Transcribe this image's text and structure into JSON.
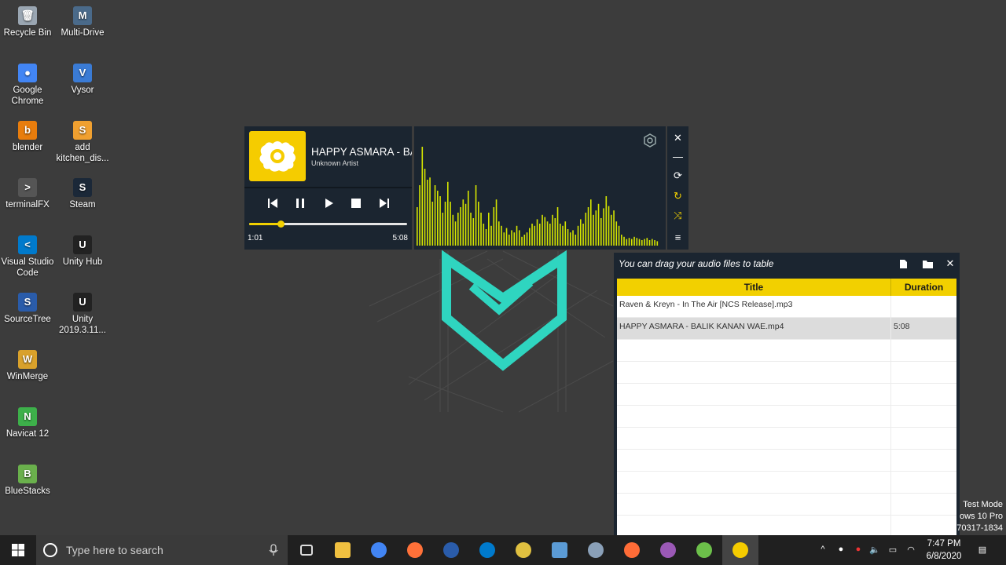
{
  "desktop": {
    "icons": [
      {
        "label": "Recycle Bin",
        "color": "#9aa6b2",
        "glyph": "🗑"
      },
      {
        "label": "Multi-Drive",
        "color": "#4a6a8a",
        "glyph": "M"
      },
      {
        "label": "Google Chrome",
        "color": "#4285f4",
        "glyph": "●"
      },
      {
        "label": "Vysor",
        "color": "#3a7bd5",
        "glyph": "V"
      },
      {
        "label": "blender",
        "color": "#e87d0d",
        "glyph": "b"
      },
      {
        "label": "add kitchen_dis...",
        "color": "#f0a030",
        "glyph": "S"
      },
      {
        "label": "terminalFX",
        "color": "#555555",
        "glyph": ">"
      },
      {
        "label": "Steam",
        "color": "#1b2838",
        "glyph": "S"
      },
      {
        "label": "Visual Studio Code",
        "color": "#007acc",
        "glyph": "<"
      },
      {
        "label": "Unity Hub",
        "color": "#222222",
        "glyph": "U"
      },
      {
        "label": "SourceTree",
        "color": "#2a5caa",
        "glyph": "S"
      },
      {
        "label": "Unity 2019.3.11...",
        "color": "#222222",
        "glyph": "U"
      },
      {
        "label": "WinMerge",
        "color": "#d9a12b",
        "glyph": "W"
      },
      {
        "label": "Navicat 12",
        "color": "#3db04a",
        "glyph": "N"
      },
      {
        "label": "BlueStacks",
        "color": "#6ab04c",
        "glyph": "B"
      }
    ]
  },
  "player": {
    "title": "HAPPY ASMARA - BALIK KANAN WAE",
    "artist": "Unknown Artist",
    "current_time": "1:01",
    "total_time": "5:08",
    "progress": 0.2,
    "accent": "#f2d000",
    "panel_bg": "#1b2530"
  },
  "visualizer": {
    "bar_color": "#d6e600",
    "levels": [
      0.35,
      0.55,
      0.9,
      0.7,
      0.6,
      0.62,
      0.4,
      0.55,
      0.5,
      0.45,
      0.3,
      0.4,
      0.58,
      0.4,
      0.28,
      0.22,
      0.3,
      0.35,
      0.42,
      0.38,
      0.5,
      0.3,
      0.25,
      0.55,
      0.4,
      0.3,
      0.2,
      0.15,
      0.3,
      0.18,
      0.35,
      0.42,
      0.22,
      0.18,
      0.12,
      0.16,
      0.1,
      0.14,
      0.12,
      0.18,
      0.14,
      0.08,
      0.1,
      0.12,
      0.16,
      0.2,
      0.18,
      0.24,
      0.2,
      0.28,
      0.26,
      0.22,
      0.2,
      0.28,
      0.25,
      0.35,
      0.2,
      0.18,
      0.22,
      0.15,
      0.12,
      0.14,
      0.1,
      0.18,
      0.24,
      0.2,
      0.3,
      0.35,
      0.42,
      0.28,
      0.32,
      0.38,
      0.25,
      0.34,
      0.45,
      0.36,
      0.28,
      0.32,
      0.22,
      0.18,
      0.1,
      0.08,
      0.06,
      0.07,
      0.06,
      0.08,
      0.07,
      0.06,
      0.05,
      0.06,
      0.07,
      0.05,
      0.06,
      0.05,
      0.04
    ]
  },
  "side_buttons": [
    "✕",
    "—",
    "⟳",
    "↻",
    "⤨",
    "≡"
  ],
  "playlist": {
    "hint": "You can drag your audio files to table",
    "columns": {
      "title": "Title",
      "duration": "Duration"
    },
    "rows": [
      {
        "title": "Raven & Kreyn - In The Air [NCS Release].mp3",
        "duration": ""
      },
      {
        "title": "HAPPY ASMARA - BALIK KANAN WAE.mp4",
        "duration": "5:08",
        "selected": true
      }
    ],
    "empty_rows": 9
  },
  "watermark": {
    "line1": "Test Mode",
    "line2": "ows 10 Pro",
    "line3": "70317-1834"
  },
  "taskbar": {
    "search_placeholder": "Type here to search",
    "time": "7:47 PM",
    "date": "6/8/2020",
    "apps": [
      {
        "name": "task-view",
        "color": "#202020"
      },
      {
        "name": "file-explorer",
        "color": "#f0c040"
      },
      {
        "name": "chrome",
        "color": "#4285f4"
      },
      {
        "name": "firefox",
        "color": "#ff7139"
      },
      {
        "name": "sourcetree",
        "color": "#2a5caa"
      },
      {
        "name": "vscode",
        "color": "#007acc"
      },
      {
        "name": "git-tool",
        "color": "#e0c040"
      },
      {
        "name": "3d-builder",
        "color": "#5b9bd5"
      },
      {
        "name": "explorer-window",
        "color": "#8aa0b8"
      },
      {
        "name": "postman",
        "color": "#ff6c37"
      },
      {
        "name": "media-app",
        "color": "#9b59b6"
      },
      {
        "name": "clover-app",
        "color": "#6cc04a"
      },
      {
        "name": "music-player",
        "color": "#f5cc00"
      }
    ]
  }
}
